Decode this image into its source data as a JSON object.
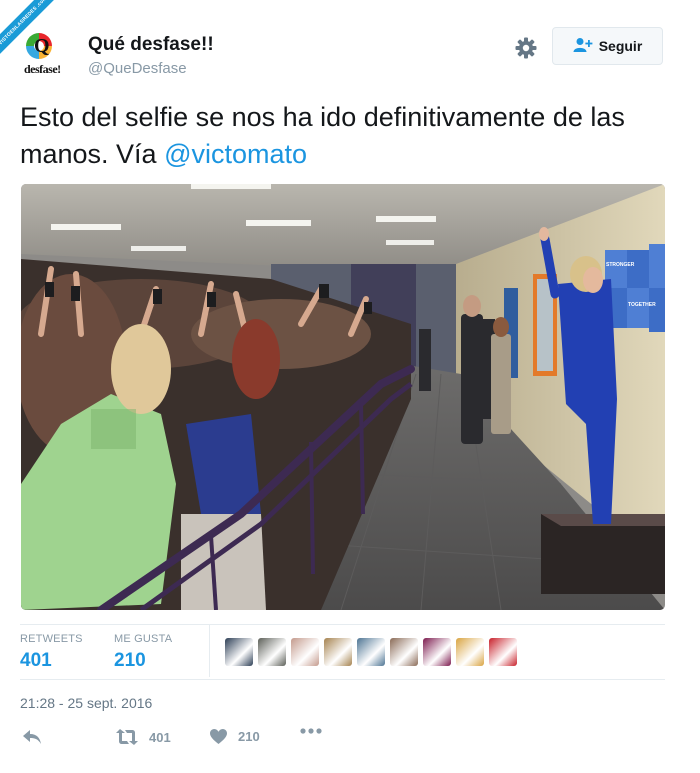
{
  "watermark": {
    "text": "VISTOENLASREDES .com"
  },
  "author": {
    "avatar_big": "Q",
    "avatar_small": "desfase!",
    "name": "Qué desfase!!",
    "handle": "@QueDesfase"
  },
  "header": {
    "settings_icon": "gear-icon",
    "follow_icon": "add-user-icon",
    "follow_label": "Seguir"
  },
  "tweet": {
    "text": "Esto del selfie se nos ha ido definitivamente de las manos. Vía ",
    "mention": "@victomato",
    "media_description_icon": "photo"
  },
  "photo_signs": {
    "line1": "STRONGER",
    "line2": "TOGETHER"
  },
  "stats": {
    "retweets_label": "RETWEETS",
    "retweets_count": "401",
    "likes_label": "ME GUSTA",
    "likes_count": "210",
    "liker_colors": [
      "#2c3e55",
      "#5c5f58",
      "#c49a8c",
      "#a5824e",
      "#4d7493",
      "#8a6a56",
      "#7c1a4e",
      "#d9a441",
      "#c8202a"
    ]
  },
  "timestamp": "21:28 - 25 sept. 2016",
  "actions": {
    "reply_icon": "reply-icon",
    "retweet_icon": "retweet-icon",
    "retweet_count": "401",
    "like_icon": "heart-icon",
    "like_count": "210",
    "more_icon": "more-icon"
  },
  "colors": {
    "link": "#1b95e0",
    "muted": "#8899a6",
    "border": "#e6ecf0"
  }
}
